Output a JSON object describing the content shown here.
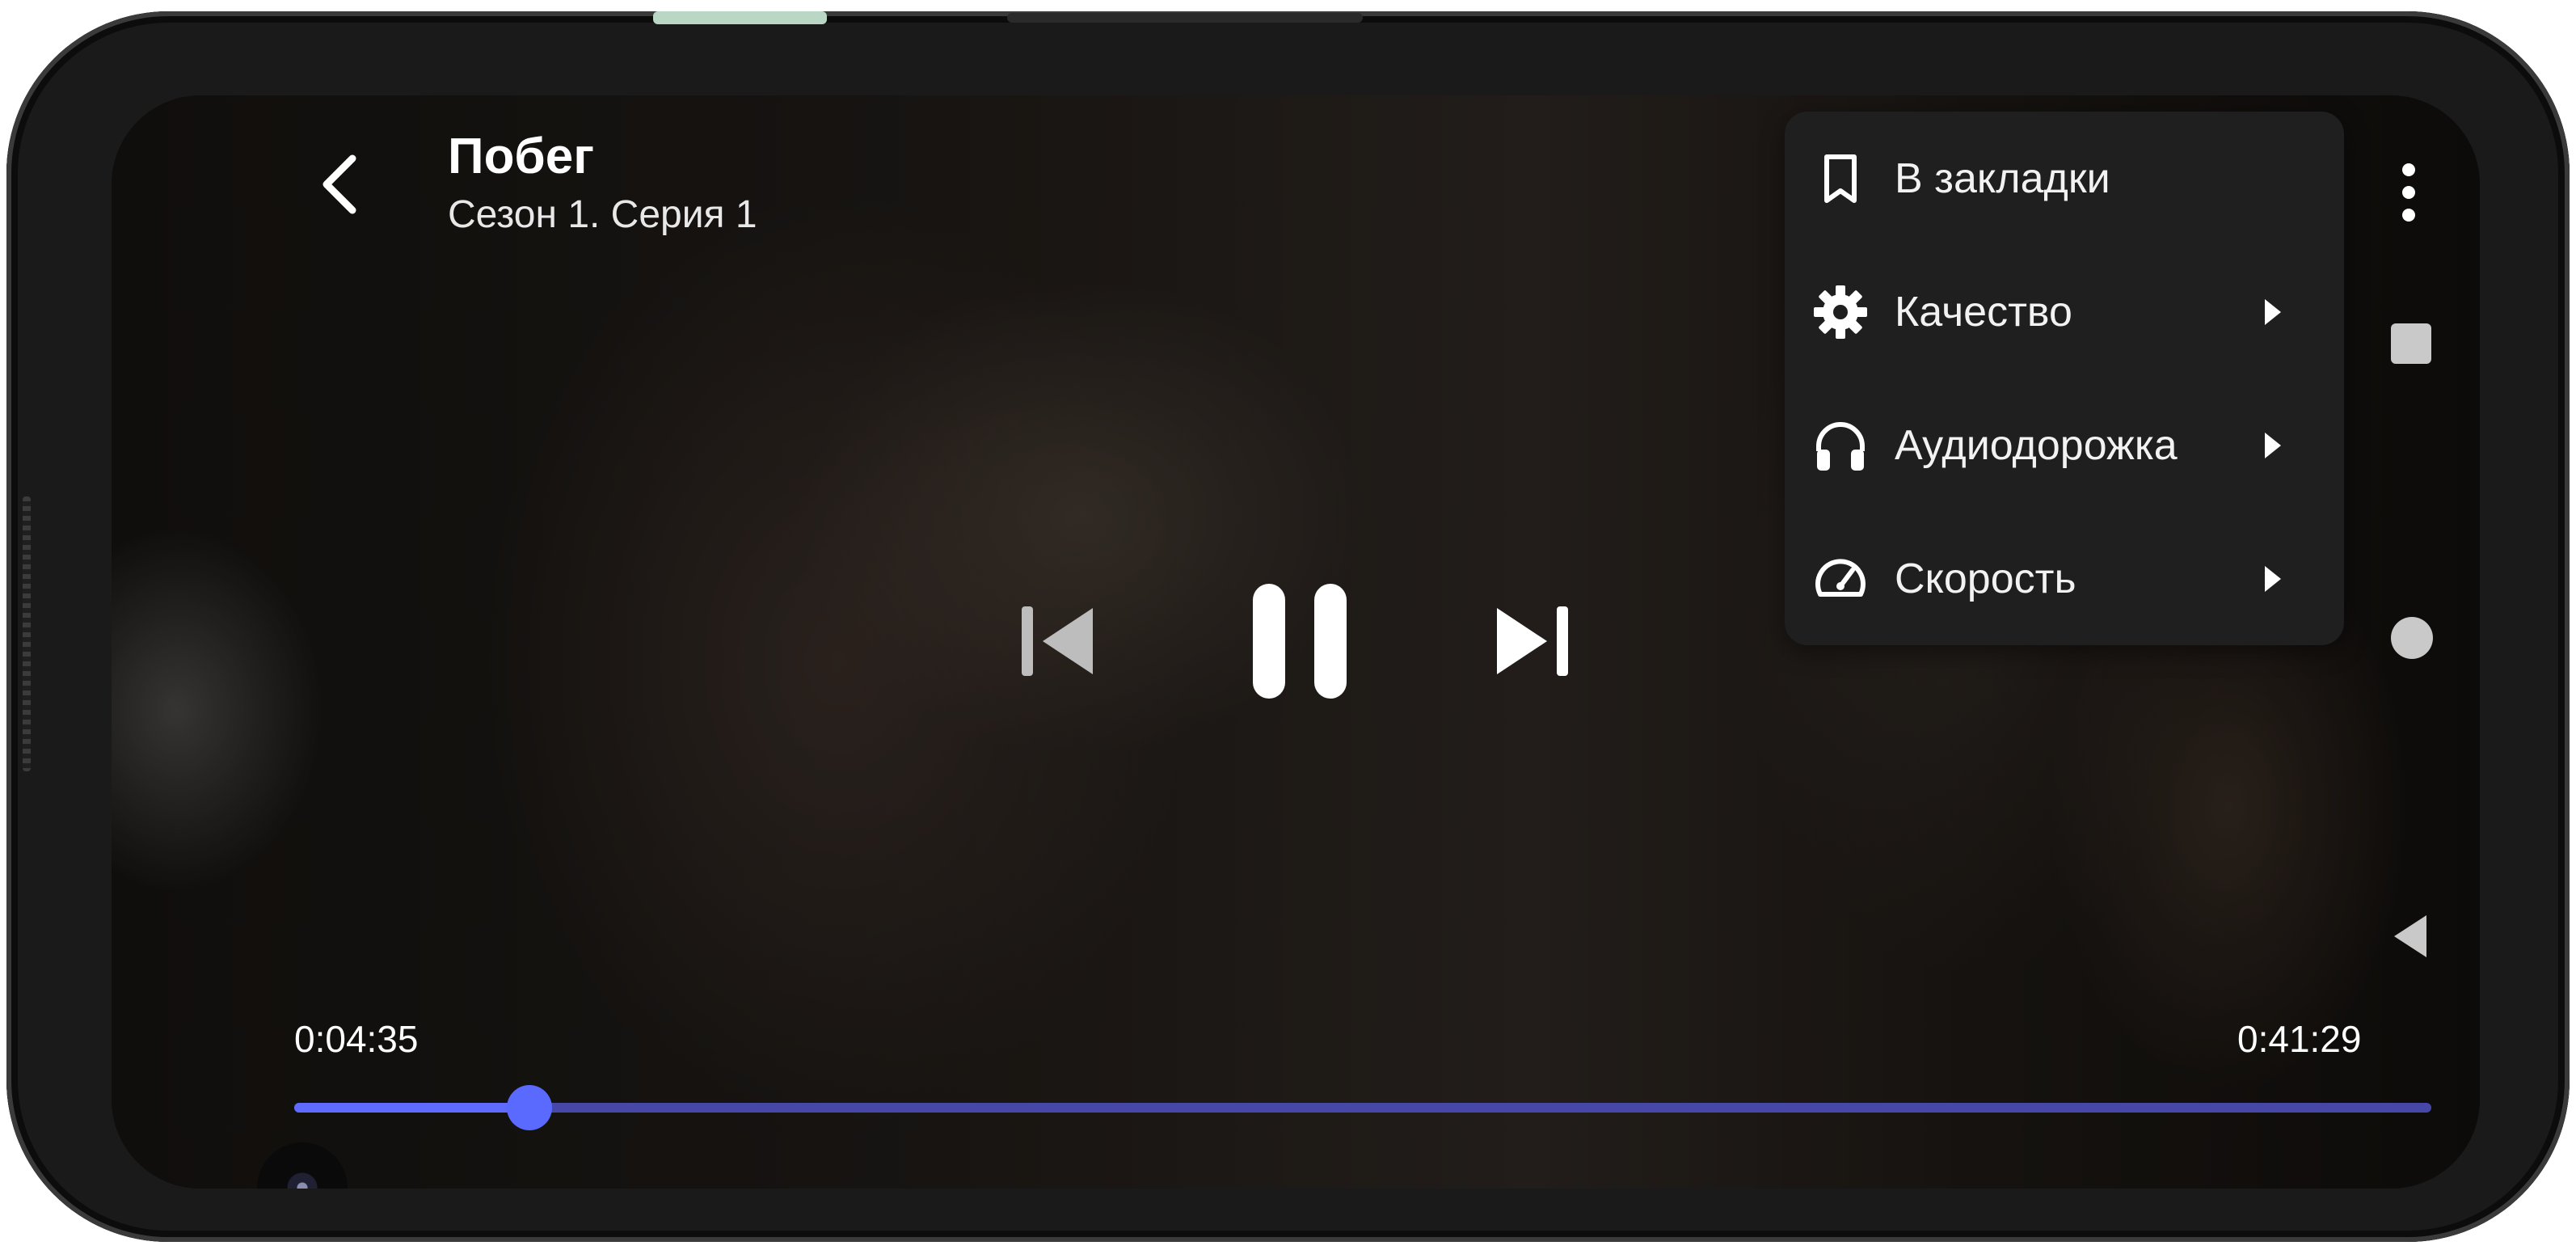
{
  "player": {
    "title": "Побег",
    "subtitle": "Сезон 1. Серия 1",
    "time_elapsed": "0:04:35",
    "time_total": "0:41:29",
    "progress_fraction": 0.11,
    "accent_color": "#5f6bff"
  },
  "menu": {
    "items": [
      {
        "label": "В закладки",
        "icon": "bookmark-icon",
        "has_submenu": false
      },
      {
        "label": "Качество",
        "icon": "gear-icon",
        "has_submenu": true
      },
      {
        "label": "Аудиодорожка",
        "icon": "headphones-icon",
        "has_submenu": true
      },
      {
        "label": "Скорость",
        "icon": "speedometer-icon",
        "has_submenu": true
      }
    ]
  },
  "controls": {
    "prev": "skip-previous-icon",
    "play_state": "pause-icon",
    "next": "skip-next-icon"
  }
}
